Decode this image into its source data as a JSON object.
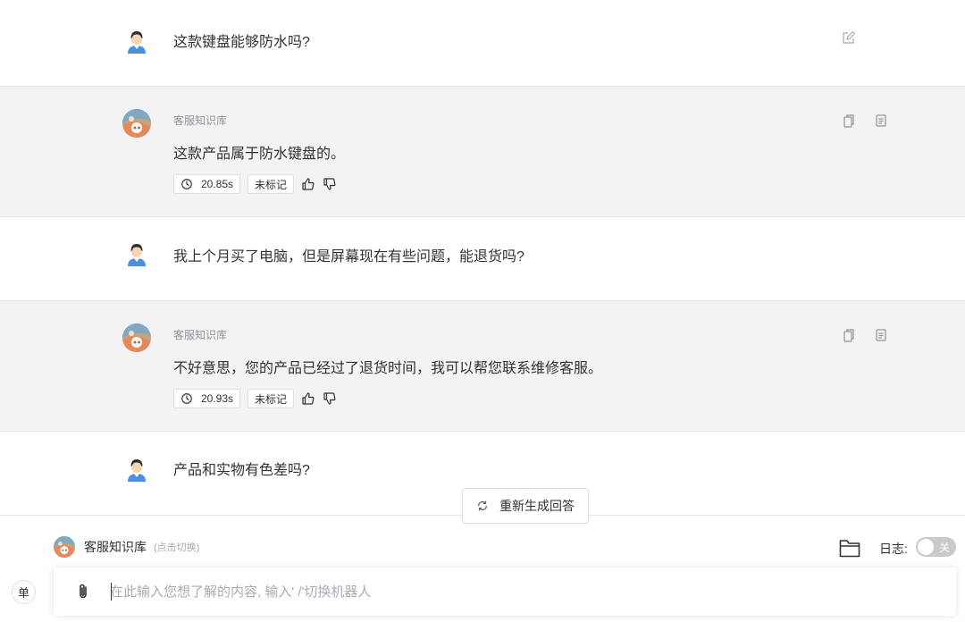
{
  "messages": [
    {
      "role": "user",
      "text": "这款键盘能够防水吗?"
    },
    {
      "role": "bot",
      "bot_name": "客服知识库",
      "text": "这款产品属于防水键盘的。",
      "duration": "20.85s",
      "mark_status": "未标记"
    },
    {
      "role": "user",
      "text": "我上个月买了电脑，但是屏幕现在有些问题，能退货吗?"
    },
    {
      "role": "bot",
      "bot_name": "客服知识库",
      "text": "不好意思，您的产品已经过了退货时间，我可以帮您联系维修客服。",
      "duration": "20.93s",
      "mark_status": "未标记"
    },
    {
      "role": "user",
      "text": "产品和实物有色差吗?"
    }
  ],
  "regenerate_label": "重新生成回答",
  "footer": {
    "bot_name": "客服知识库",
    "switch_hint": "(点击切换)",
    "log_label": "日志:",
    "log_toggle_label": "关"
  },
  "input": {
    "mode_label": "单",
    "placeholder": "在此输入您想了解的内容, 输入' /'切换机器人"
  },
  "icons": {
    "user_avatar": "user-avatar-icon",
    "bot_avatar": "bot-avatar-icon",
    "edit": "edit-icon",
    "copy": "copy-icon",
    "note": "note-icon",
    "clock": "clock-icon",
    "thumbs_up": "thumbs-up-icon",
    "thumbs_down": "thumbs-down-icon",
    "refresh": "refresh-icon",
    "folder": "folder-icon",
    "paperclip": "paperclip-icon"
  },
  "colors": {
    "bot_row_bg": "#f3f3f4",
    "text": "#303133",
    "muted": "#909399",
    "border": "#dcdfe6",
    "toggle_off": "#c8c9cc"
  }
}
